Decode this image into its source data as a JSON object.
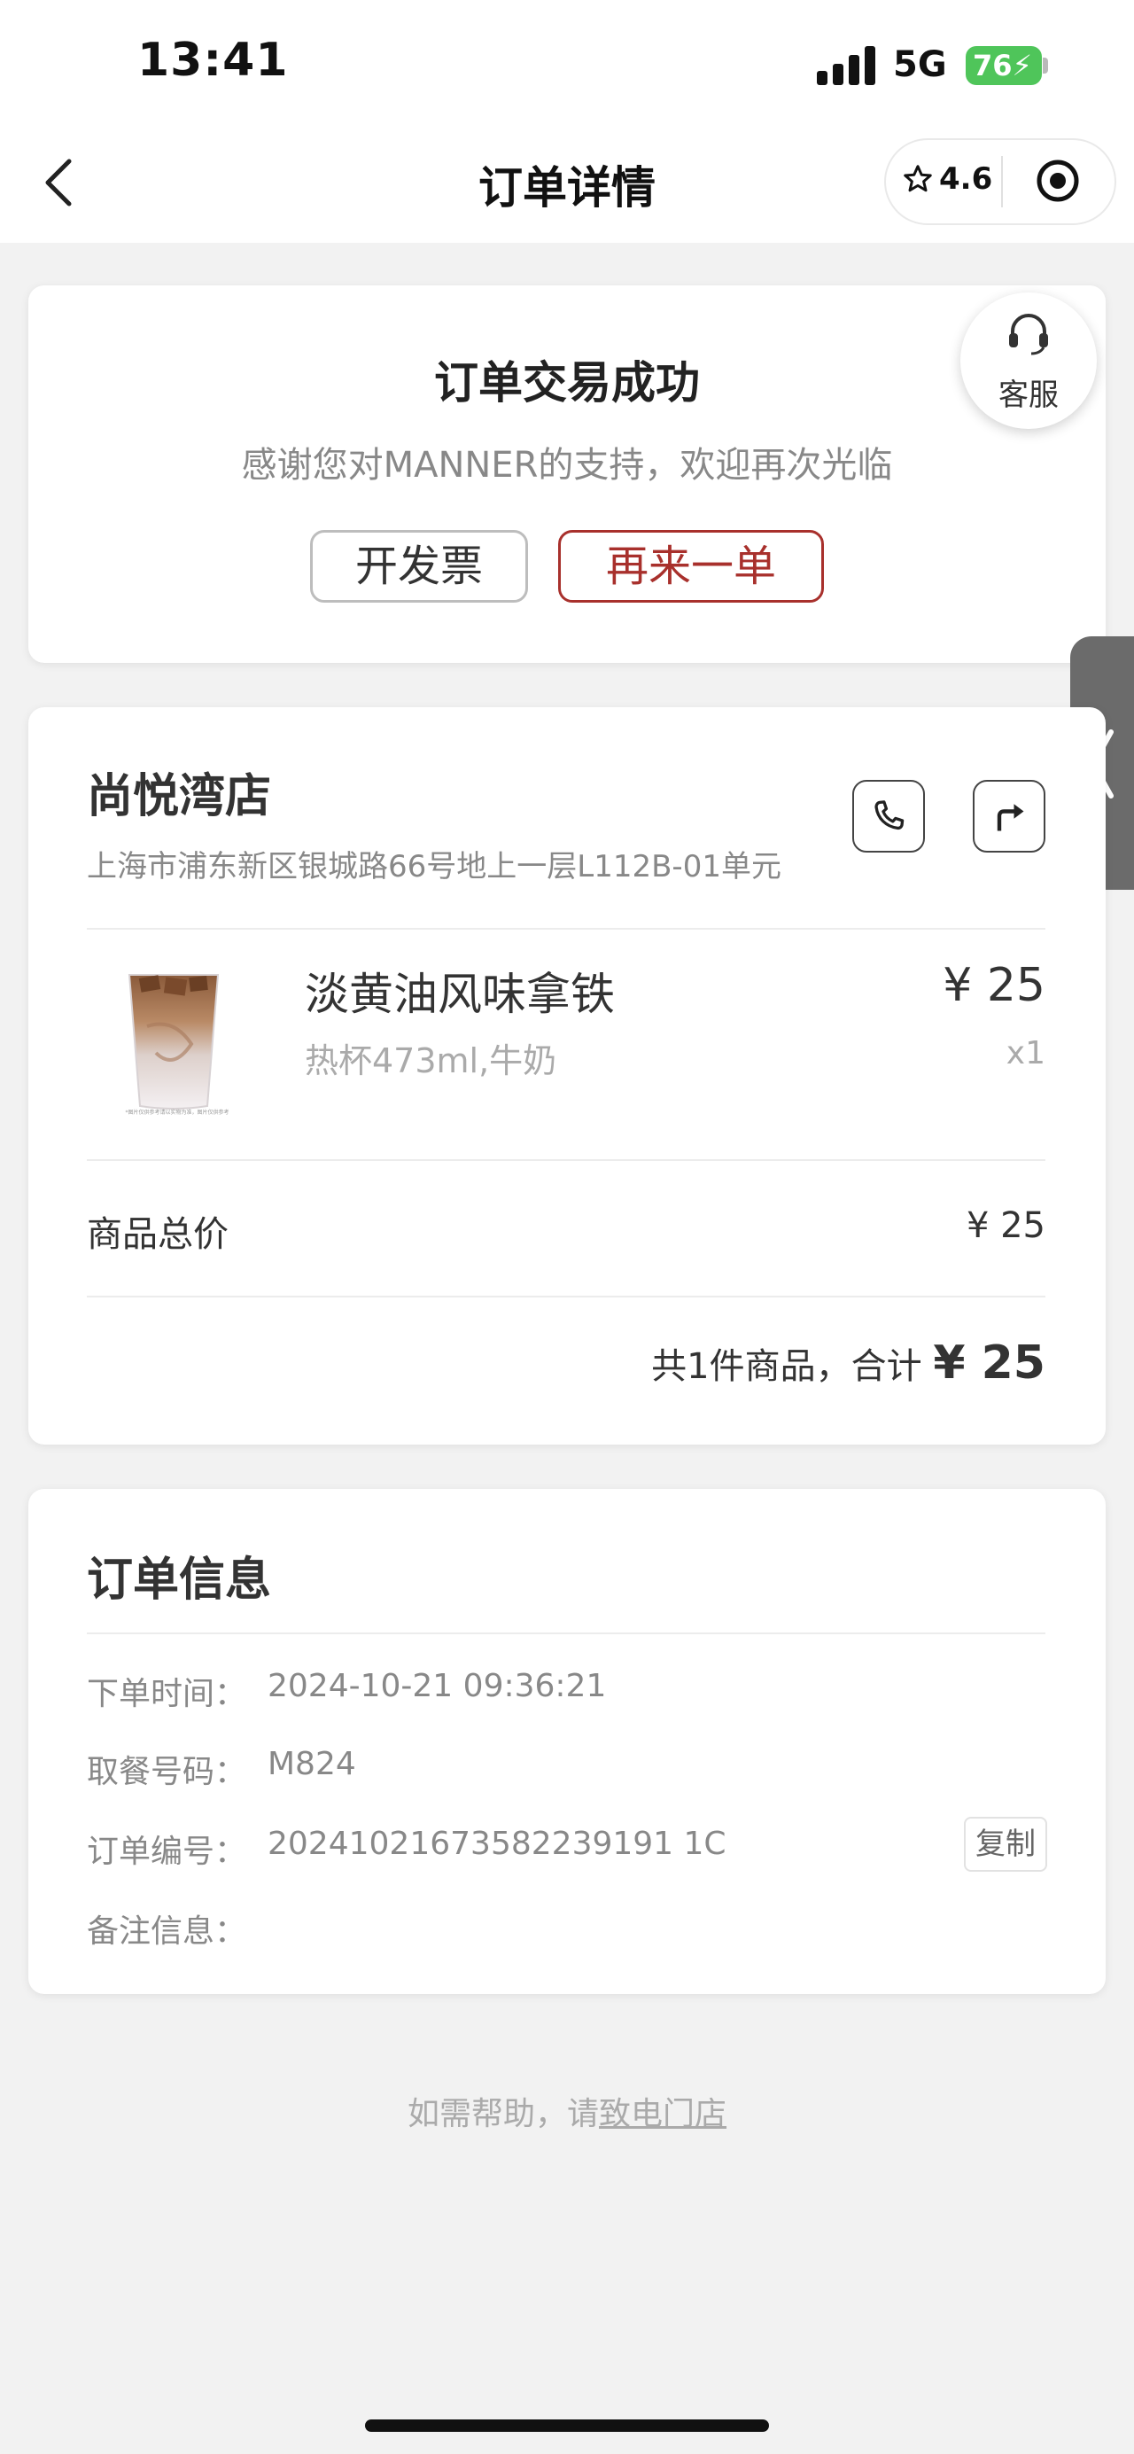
{
  "status_bar": {
    "time": "13:41",
    "network": "5G",
    "battery": "76"
  },
  "nav": {
    "title": "订单详情",
    "rating": "4.6"
  },
  "order_status": {
    "title": "订单交易成功",
    "subtitle": "感谢您对MANNER的支持，欢迎再次光临",
    "invoice_button": "开发票",
    "reorder_button": "再来一单"
  },
  "customer_service": {
    "label": "客服"
  },
  "store": {
    "name": "尚悦湾店",
    "address": "上海市浦东新区银城路66号地上一层L112B-01单元"
  },
  "product": {
    "name": "淡黄油风味拿铁",
    "spec": "热杯473ml,牛奶",
    "price": "¥ 25",
    "qty": "x1",
    "image_caption": "*图片仅供参考请以实物为准，图片仅供参考"
  },
  "summary": {
    "subtotal_label": "商品总价",
    "subtotal_value": "¥ 25",
    "total_prefix": "共1件商品，合计",
    "total_value": "¥ 25"
  },
  "order_info": {
    "title": "订单信息",
    "rows": [
      {
        "label": "下单时间：",
        "value": "2024-10-21 09:36:21"
      },
      {
        "label": "取餐号码：",
        "value": "M824"
      },
      {
        "label": "订单编号：",
        "value": "20241021673582239191 1C"
      },
      {
        "label": "备注信息：",
        "value": ""
      }
    ],
    "copy_button": "复制"
  },
  "footer": {
    "help_prefix": "如需帮助，请",
    "help_link": "致电门店"
  },
  "colors": {
    "accent_red": "#a8302c",
    "battery_green": "#4fc55a",
    "background": "#f2f2f2"
  }
}
